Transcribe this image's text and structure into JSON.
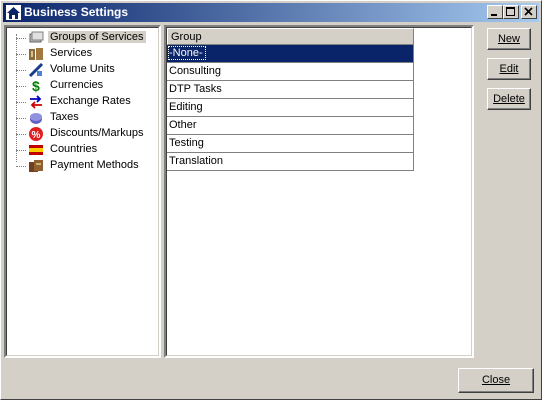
{
  "window": {
    "title": "Business Settings",
    "title_icon": "house-icon"
  },
  "tree": {
    "items": [
      {
        "label": "Groups of Services",
        "icon": "groups-icon",
        "selected": true
      },
      {
        "label": "Services",
        "icon": "services-icon"
      },
      {
        "label": "Volume Units",
        "icon": "volume-units-icon"
      },
      {
        "label": "Currencies",
        "icon": "dollar-icon"
      },
      {
        "label": "Exchange Rates",
        "icon": "exchange-arrows-icon"
      },
      {
        "label": "Taxes",
        "icon": "taxes-icon"
      },
      {
        "label": "Discounts/Markups",
        "icon": "percent-icon"
      },
      {
        "label": "Countries",
        "icon": "flag-icon"
      },
      {
        "label": "Payment Methods",
        "icon": "payment-icon"
      }
    ]
  },
  "grid": {
    "column_header": "Group",
    "rows": [
      "-None-",
      "Consulting",
      "DTP Tasks",
      "Editing",
      "Other",
      "Testing",
      "Translation"
    ],
    "selected_index": 0
  },
  "buttons": {
    "new": "New",
    "edit": "Edit",
    "delete": "Delete",
    "close": "Close"
  },
  "colors": {
    "titlebar": "#0a246a",
    "selection": "#0a246a",
    "face": "#d4d0c8"
  }
}
